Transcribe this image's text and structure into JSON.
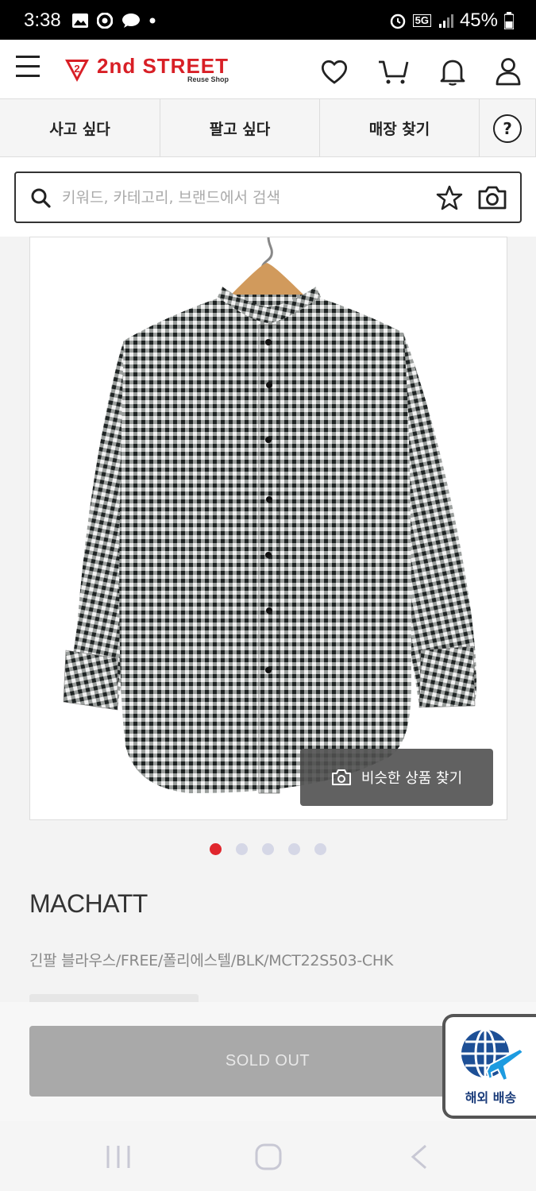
{
  "status_bar": {
    "time": "3:38",
    "battery": "45%",
    "network": "5G"
  },
  "header": {
    "logo_main": "2nd STREET",
    "logo_sub": "Reuse Shop",
    "brand_color": "#d81f26"
  },
  "tabs": [
    {
      "label": "사고 싶다"
    },
    {
      "label": "팔고 싶다"
    },
    {
      "label": "매장 찾기"
    },
    {
      "label": "?"
    }
  ],
  "search": {
    "placeholder": "키워드, 카테고리, 브랜드에서 검색",
    "value": ""
  },
  "product": {
    "similar_button": "비슷한 상품 찾기",
    "image_count": 5,
    "active_image_index": 0,
    "brand": "MACHATT",
    "description": "긴팔 블라우스/FREE/폴리에스텔/BLK/MCT22S503-CHK",
    "sold_out_label": "SOLD OUT"
  },
  "overseas": {
    "label": "해외 배송",
    "color": "#1b6fc4"
  },
  "icons": [
    "menu-icon",
    "heart-icon",
    "cart-icon",
    "bell-icon",
    "user-icon",
    "search-icon",
    "star-icon",
    "camera-icon",
    "globe-plane-icon"
  ]
}
